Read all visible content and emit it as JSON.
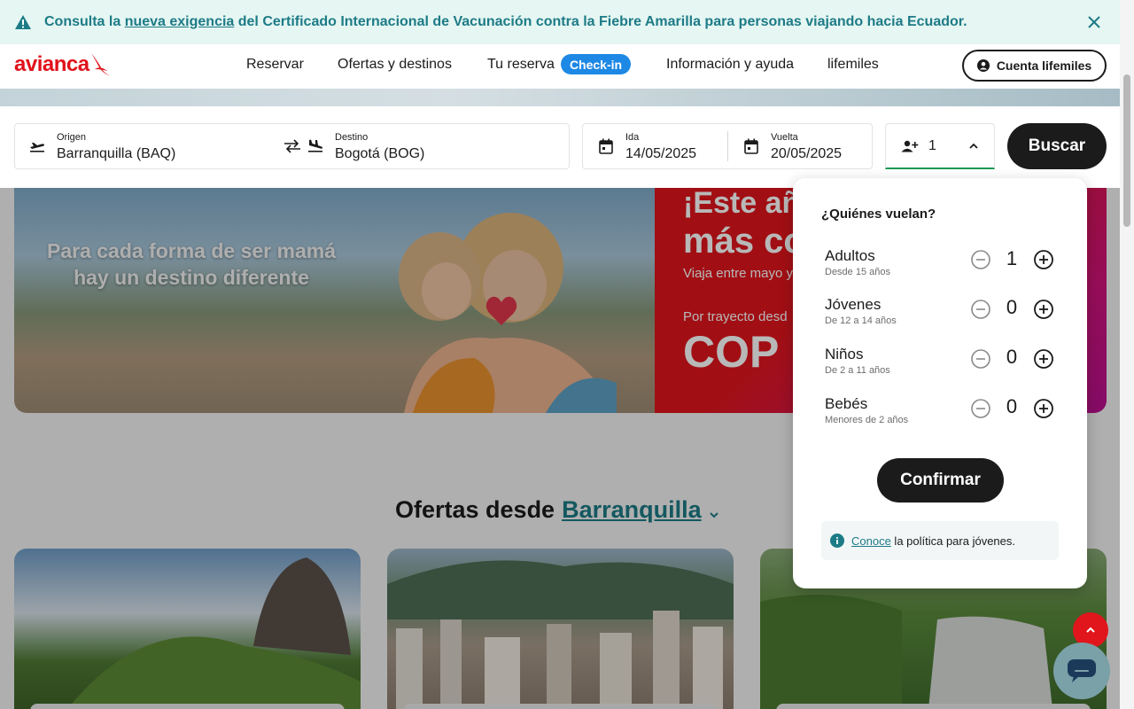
{
  "alert": {
    "prefix": "Consulta la ",
    "link": "nueva exigencia",
    "suffix": " del Certificado Internacional de Vacunación contra la Fiebre Amarilla para personas viajando hacia Ecuador.",
    "icon": "warning-icon",
    "close_icon": "close-icon"
  },
  "header": {
    "logo_text": "avianca",
    "nav": [
      "Reservar",
      "Ofertas y destinos",
      "Tu reserva",
      "Información y ayuda",
      "lifemiles"
    ],
    "checkin_label": "Check-in",
    "account_label": "Cuenta lifemiles",
    "account_icon": "user-icon"
  },
  "search": {
    "origin_label": "Origen",
    "origin_value": "Barranquilla  (BAQ)",
    "destination_label": "Destino",
    "destination_value": "Bogotá  (BOG)",
    "depart_label": "Ida",
    "depart_value": "14/05/2025",
    "return_label": "Vuelta",
    "return_value": "20/05/2025",
    "passengers_value": "1",
    "search_label": "Buscar"
  },
  "hero": {
    "tagline": "Para cada forma de ser mamá hay un destino diferente",
    "headline1": "¡Este añ",
    "headline2": "más co",
    "line1": "Viaja entre mayo y",
    "line2": "Por trayecto desd",
    "price": "COP"
  },
  "offers": {
    "title": "Ofertas desde",
    "city": "Barranquilla"
  },
  "passengers": {
    "title": "¿Quiénes vuelan?",
    "rows": [
      {
        "name": "Adultos",
        "desc": "Desde 15 años",
        "count": "1"
      },
      {
        "name": "Jóvenes",
        "desc": "De 12 a 14 años",
        "count": "0"
      },
      {
        "name": "Niños",
        "desc": "De 2 a 11 años",
        "count": "0"
      },
      {
        "name": "Bebés",
        "desc": "Menores de 2 años",
        "count": "0"
      }
    ],
    "confirm_label": "Confirmar",
    "info_link": "Conoce",
    "info_text": " la política para jóvenes."
  },
  "colors": {
    "brand_red": "#e0161c",
    "teal": "#1d7b86",
    "checkin_blue": "#1e88e5",
    "dark": "#1b1b1b"
  }
}
